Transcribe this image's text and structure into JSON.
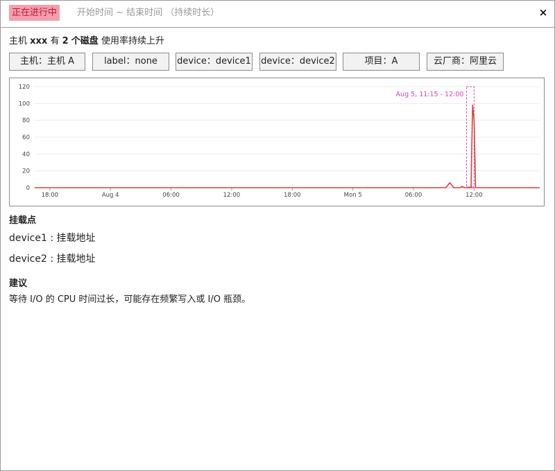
{
  "header": {
    "status": "正在进行中",
    "time_range": "开始时间 ~ 结束时间 （持续时长）",
    "close_glyph": "×"
  },
  "summary": {
    "prefix": "主机",
    "host": "xxx",
    "mid": "有",
    "count": "2",
    "unit": "个磁盘",
    "suffix": "使用率持续上升"
  },
  "tags": [
    {
      "label": "主机：主机 A"
    },
    {
      "label": "label：none"
    },
    {
      "label": "device：device1"
    },
    {
      "label": "device：device2"
    },
    {
      "label": "项目：A"
    },
    {
      "label": "云厂商：阿里云"
    }
  ],
  "chart_data": {
    "type": "line",
    "x_tick_labels": [
      "18:00",
      "Aug 4",
      "06:00",
      "12:00",
      "18:00",
      "Mon 5",
      "06:00",
      "12:00"
    ],
    "x_tick_hours": [
      18,
      24,
      30,
      36,
      42,
      48,
      54,
      60
    ],
    "xlim_hours": [
      16.5,
      66.5
    ],
    "y_ticks": [
      0,
      20,
      40,
      60,
      80,
      100,
      120
    ],
    "ylim": [
      0,
      120
    ],
    "grid": true,
    "series": [
      {
        "color": "#d9413a",
        "points": [
          [
            16.5,
            0
          ],
          [
            57.2,
            0
          ],
          [
            57.6,
            6
          ],
          [
            58.0,
            0
          ],
          [
            58.6,
            0
          ],
          [
            58.8,
            1.5
          ],
          [
            59.1,
            0
          ],
          [
            59.5,
            0
          ],
          [
            59.7,
            0
          ],
          [
            59.85,
            98
          ],
          [
            60.0,
            80
          ],
          [
            60.15,
            0
          ],
          [
            66.5,
            0
          ]
        ]
      }
    ],
    "highlight": {
      "label": "Aug 5, 11:15 - 12:00",
      "x_start_hours": 59.25,
      "x_end_hours": 60.0,
      "color": "#e040c0"
    }
  },
  "mount": {
    "title": "挂载点",
    "rows": [
      {
        "device": "device1",
        "sep": " : ",
        "path": "挂载地址"
      },
      {
        "device": "device2",
        "sep": " : ",
        "path": "挂载地址"
      }
    ]
  },
  "advice": {
    "title": "建议",
    "text": "等待 I/O 的 CPU 时间过长，可能存在频繁写入或 I/O 瓶颈。"
  }
}
